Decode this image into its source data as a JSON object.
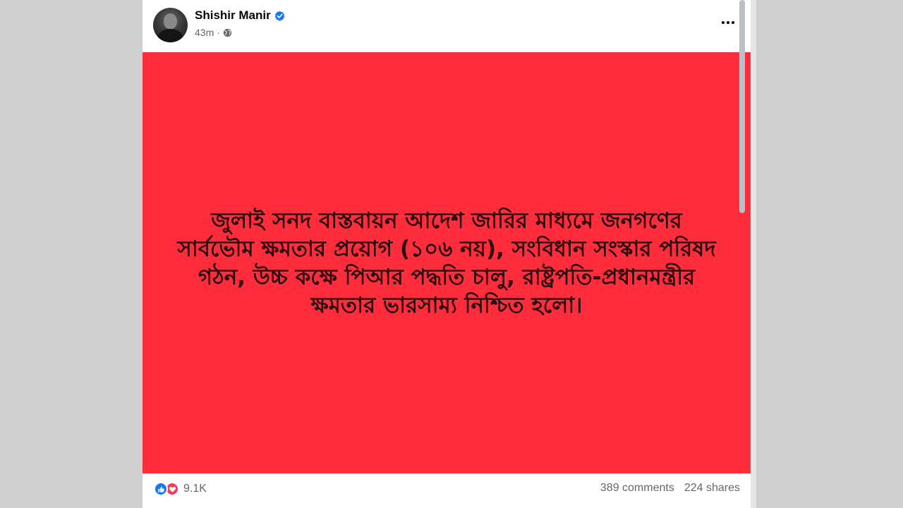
{
  "post": {
    "author": "Shishir Manir",
    "verified": true,
    "timestamp": "43m",
    "separator": "·",
    "privacy_icon": "globe-icon",
    "more_icon": "more-options-icon",
    "media_text": "জুলাই সনদ বাস্তবায়ন আদেশ জারির মাধ্যমে জনগণের সার্বভৌম ক্ষমতার প্রয়োগ (১০৬ নয়), সংবিধান সংস্কার পরিষদ গঠন, উচ্চ কক্ষে পিআর পদ্ধতি চালু, রাষ্ট্রপতি-প্রধানমন্ত্রীর ক্ষমতার ভারসাম্য নিশ্চিত হলো।",
    "media_bg": "#ff2d3b"
  },
  "footer": {
    "reaction_icons": [
      "like-icon",
      "love-icon"
    ],
    "reaction_count": "9.1K",
    "comments": "389 comments",
    "shares": "224 shares"
  }
}
